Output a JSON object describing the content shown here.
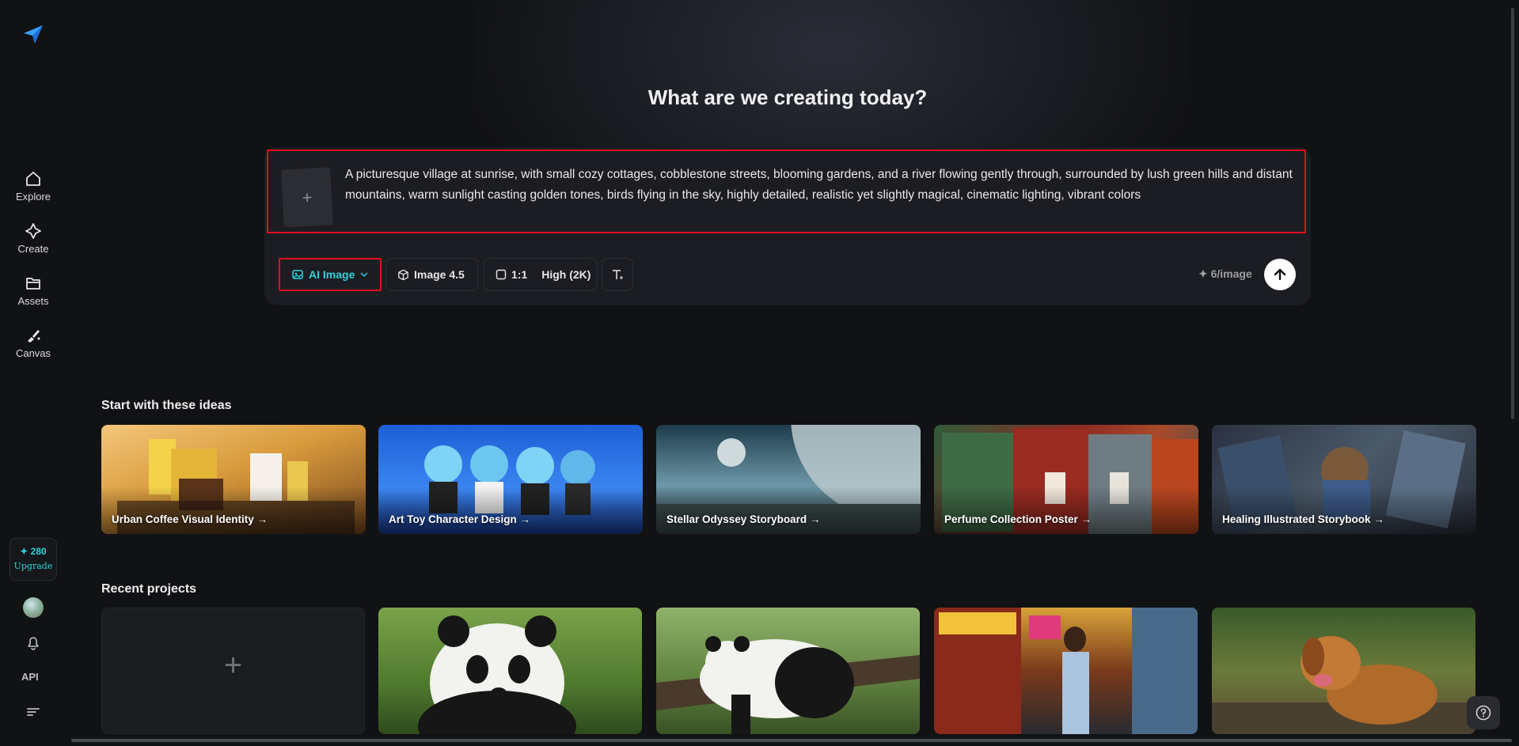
{
  "sidebar": {
    "items": [
      {
        "label": "Explore",
        "icon": "home-icon"
      },
      {
        "label": "Create",
        "icon": "sparkle-icon"
      },
      {
        "label": "Assets",
        "icon": "folder-icon"
      },
      {
        "label": "Canvas",
        "icon": "brush-icon"
      }
    ],
    "credits": "✦ 280",
    "upgrade_label": "Upgrade",
    "api_label": "API"
  },
  "main": {
    "heading": "What are we creating today?",
    "prompt": {
      "upload_symbol": "+",
      "text": "A picturesque village at sunrise, with small cozy cottages, cobblestone streets, blooming gardens, and a river flowing gently through, surrounded by lush green hills and distant mountains, warm sunlight casting golden tones, birds flying in the sky, highly detailed, realistic yet slightly magical, cinematic lighting, vibrant colors"
    },
    "toolbar": {
      "mode_label": "AI Image",
      "model_label": "Image 4.5",
      "ratio_label": "1:1",
      "quality_label": "High (2K)",
      "cost_label": "✦ 6/image"
    }
  },
  "ideas": {
    "title": "Start with these ideas",
    "cards": [
      {
        "label": "Urban Coffee Visual Identity →"
      },
      {
        "label": "Art Toy Character Design →"
      },
      {
        "label": "Stellar Odyssey Storyboard →"
      },
      {
        "label": "Perfume Collection Poster →"
      },
      {
        "label": "Healing Illustrated Storybook →"
      }
    ]
  },
  "projects": {
    "title": "Recent projects",
    "new_symbol": "+"
  },
  "colors": {
    "accent": "#2fd1dc",
    "highlight_border": "#e00f1f",
    "background": "#111214"
  }
}
